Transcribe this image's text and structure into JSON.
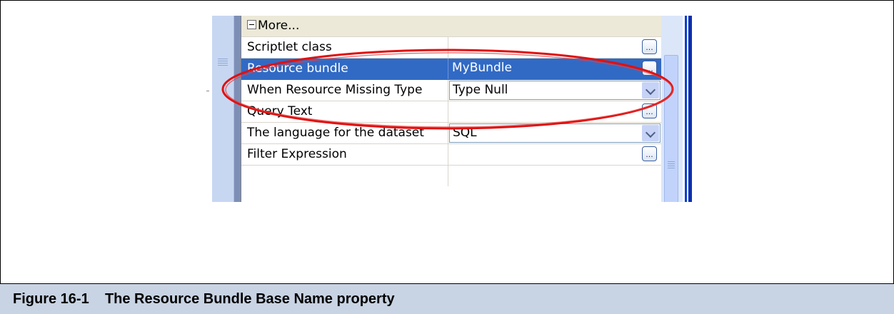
{
  "property_sheet": {
    "category_label": "More...",
    "rows": [
      {
        "name": "Scriptlet class",
        "value": ""
      },
      {
        "name": "Resource bundle",
        "value": "MyBundle"
      },
      {
        "name": "When Resource Missing Type",
        "value": "Type Null"
      },
      {
        "name": "Query Text",
        "value": ""
      },
      {
        "name": "The language for the dataset",
        "value": "SQL"
      },
      {
        "name": "Filter Expression",
        "value": ""
      }
    ],
    "ellipsis_label": "...",
    "selected_row": "Resource bundle"
  },
  "caption": {
    "figure_number": "Figure 16-1",
    "title": "The Resource Bundle Base Name property"
  },
  "colors": {
    "selection": "#316ac5",
    "highlight_ellipse": "#e01010",
    "caption_band": "#c8d3e3"
  }
}
